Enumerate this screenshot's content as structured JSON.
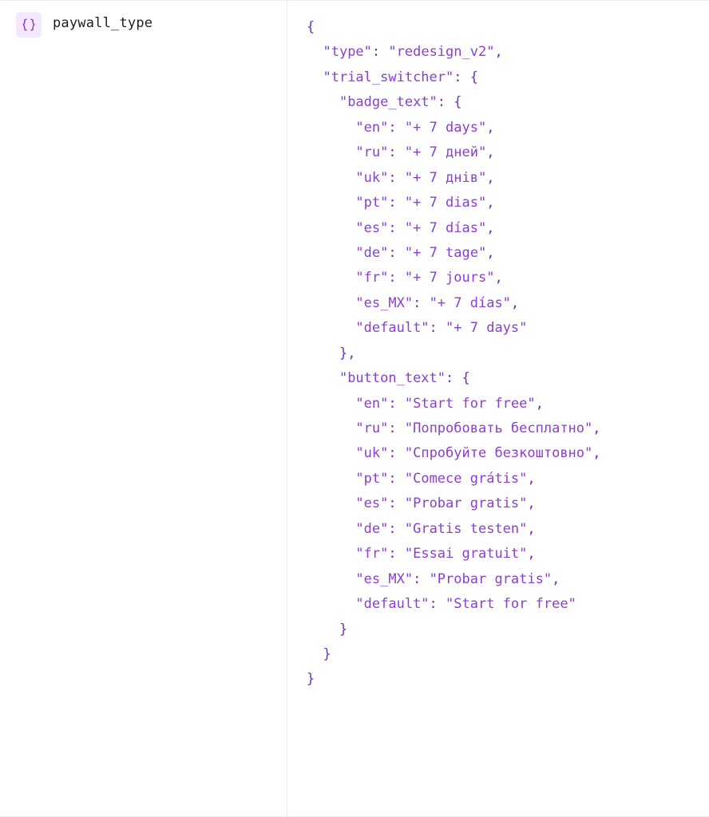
{
  "row": {
    "key": "paywall_type",
    "icon": "braces-icon"
  },
  "json": {
    "type": "redesign_v2",
    "trial_switcher": {
      "badge_text": {
        "en": "+ 7 days",
        "ru": "+ 7 дней",
        "uk": "+ 7 днів",
        "pt": "+ 7 dias",
        "es": "+ 7 días",
        "de": "+ 7 tage",
        "fr": "+ 7 jours",
        "es_MX": "+ 7 días",
        "default": "+ 7 days"
      },
      "button_text": {
        "en": "Start for free",
        "ru": "Попробовать бесплатно",
        "uk": "Спробуйте безкоштовно",
        "pt": "Comece grátis",
        "es": "Probar gratis",
        "de": "Gratis testen",
        "fr": "Essai gratuit",
        "es_MX": "Probar gratis",
        "default": "Start for free"
      }
    }
  },
  "json_key_order": {
    "": [
      "type",
      "trial_switcher"
    ],
    "trial_switcher": [
      "badge_text",
      "button_text"
    ],
    "trial_switcher.badge_text": [
      "en",
      "ru",
      "uk",
      "pt",
      "es",
      "de",
      "fr",
      "es_MX",
      "default"
    ],
    "trial_switcher.button_text": [
      "en",
      "ru",
      "uk",
      "pt",
      "es",
      "de",
      "fr",
      "es_MX",
      "default"
    ]
  }
}
